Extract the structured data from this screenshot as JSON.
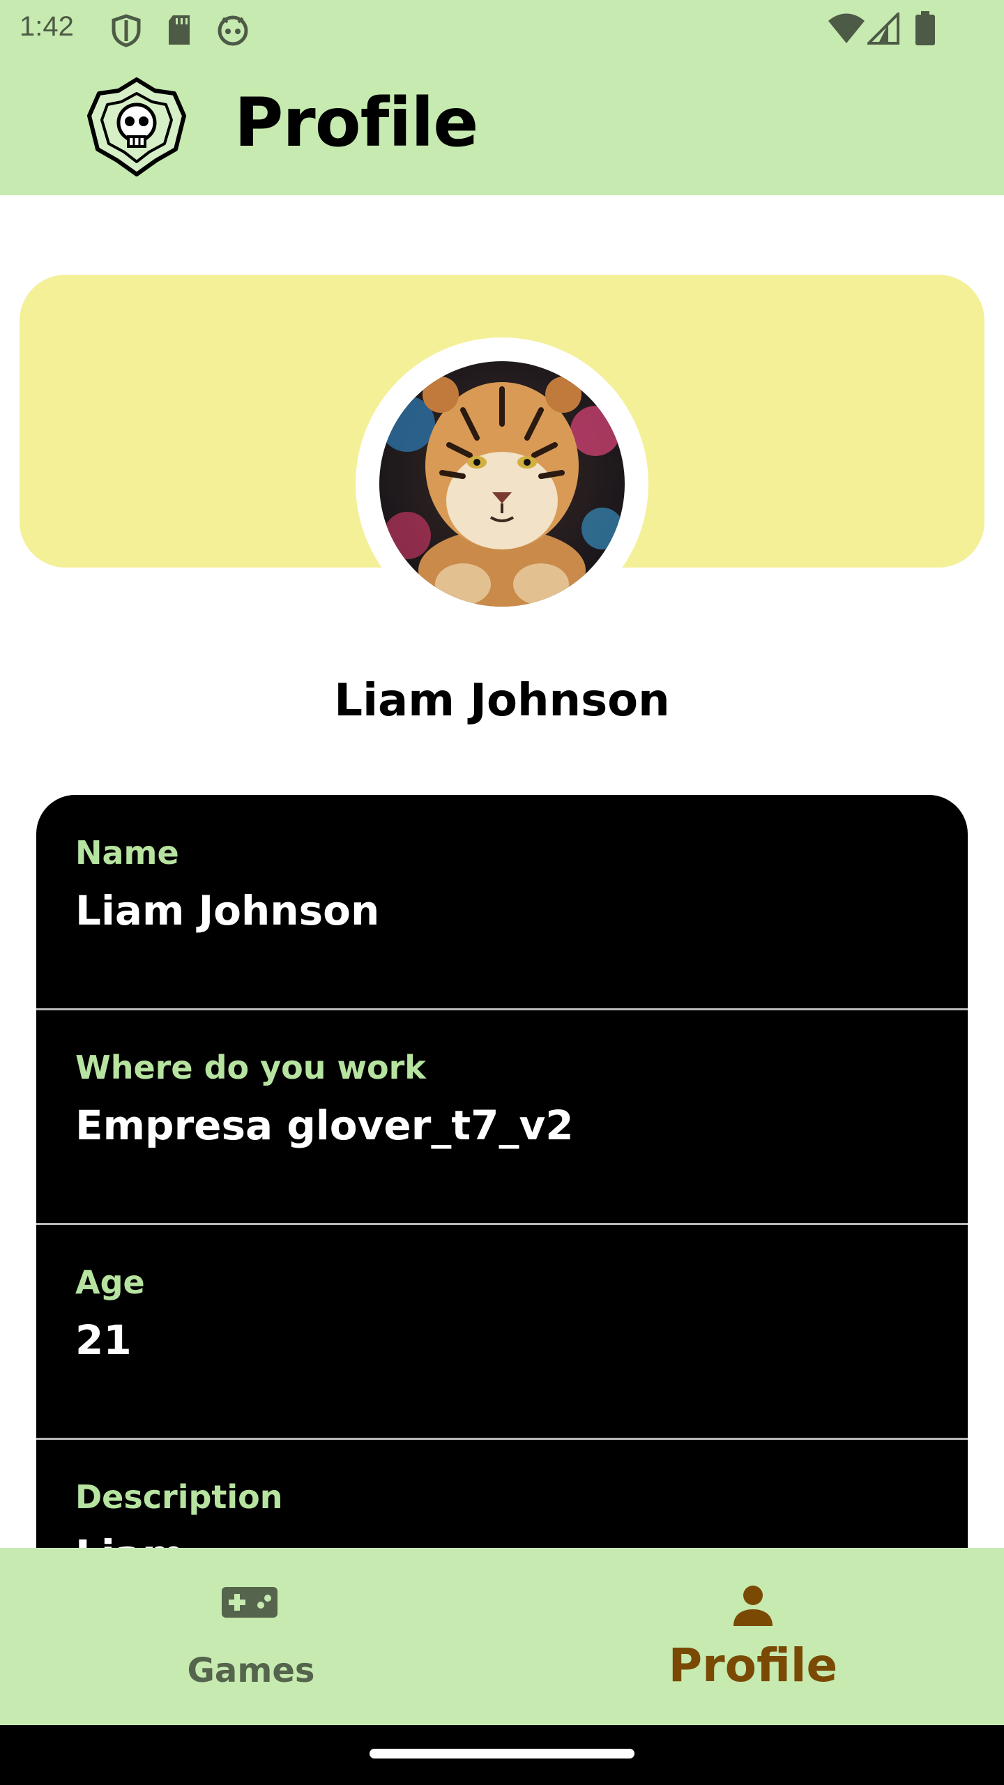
{
  "status_bar": {
    "time": "1:42",
    "left_icons": [
      "shield-icon",
      "sd-card-icon",
      "android-face-icon"
    ],
    "right_icons": [
      "wifi-icon",
      "cellular-signal-icon",
      "battery-icon"
    ]
  },
  "app_bar": {
    "title": "Profile",
    "logo_icon": "skull-badge-logo"
  },
  "profile": {
    "display_name": "Liam Johnson",
    "avatar": "tiger-avatar"
  },
  "info": {
    "rows": [
      {
        "label": "Name",
        "value": "Liam Johnson"
      },
      {
        "label": "Where do you work",
        "value": "Empresa glover_t7_v2"
      },
      {
        "label": "Age",
        "value": "21"
      },
      {
        "label": "Description",
        "value": "Liam"
      }
    ]
  },
  "bottom_nav": {
    "items": [
      {
        "label": "Games",
        "icon": "gamepad-icon",
        "selected": false
      },
      {
        "label": "Profile",
        "icon": "person-icon",
        "selected": true
      }
    ]
  },
  "colors": {
    "app_bar_bg": "#c6eab0",
    "banner_bg": "#f4f098",
    "card_bg": "#000000",
    "label_green": "#b7e3a0",
    "nav_selected": "#7a4a05",
    "nav_unselected": "#55644c"
  }
}
